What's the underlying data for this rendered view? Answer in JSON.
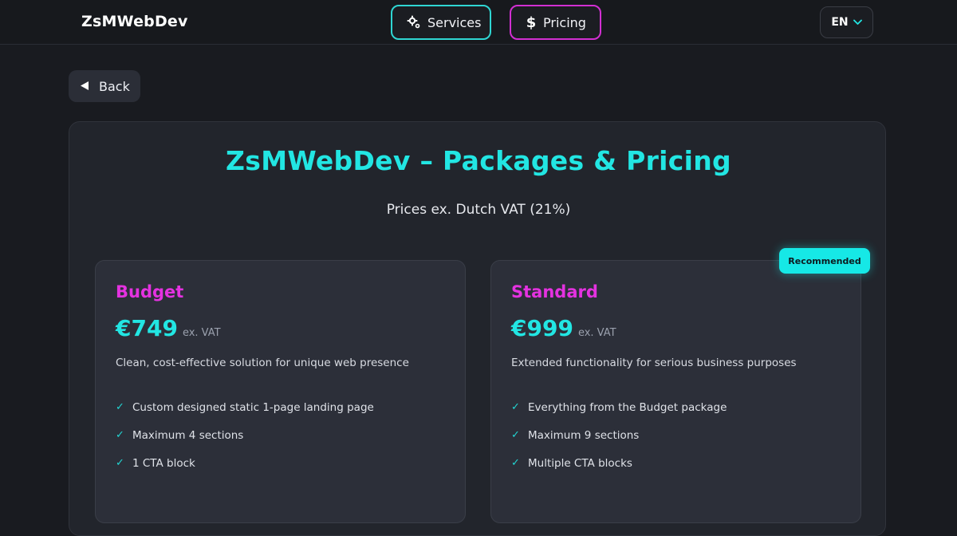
{
  "header": {
    "brand": "ZsMWebDev",
    "nav": [
      {
        "label": "Services",
        "icon": "gears-icon"
      },
      {
        "label": "Pricing",
        "icon": "dollar-icon"
      }
    ],
    "language": "EN"
  },
  "back_label": "Back",
  "pricing": {
    "title": "ZsMWebDev – Packages & Pricing",
    "subtitle": "Prices ex. Dutch VAT (21%)",
    "packages": [
      {
        "name": "Budget",
        "price": "€749",
        "vat_note": "ex. VAT",
        "description": "Clean, cost-effective solution for unique web presence",
        "features": [
          "Custom designed static 1-page landing page",
          "Maximum 4 sections",
          "1 CTA block"
        ]
      },
      {
        "name": "Standard",
        "badge": "Recommended",
        "price": "€999",
        "vat_note": "ex. VAT",
        "description": "Extended functionality for serious business purposes",
        "features": [
          "Everything from the Budget package",
          "Maximum 9 sections",
          "Multiple CTA blocks"
        ]
      }
    ]
  },
  "colors": {
    "accent_cyan": "#22e6e3",
    "accent_magenta": "#e432e0",
    "background": "#191b20",
    "card": "#2c2f39"
  }
}
